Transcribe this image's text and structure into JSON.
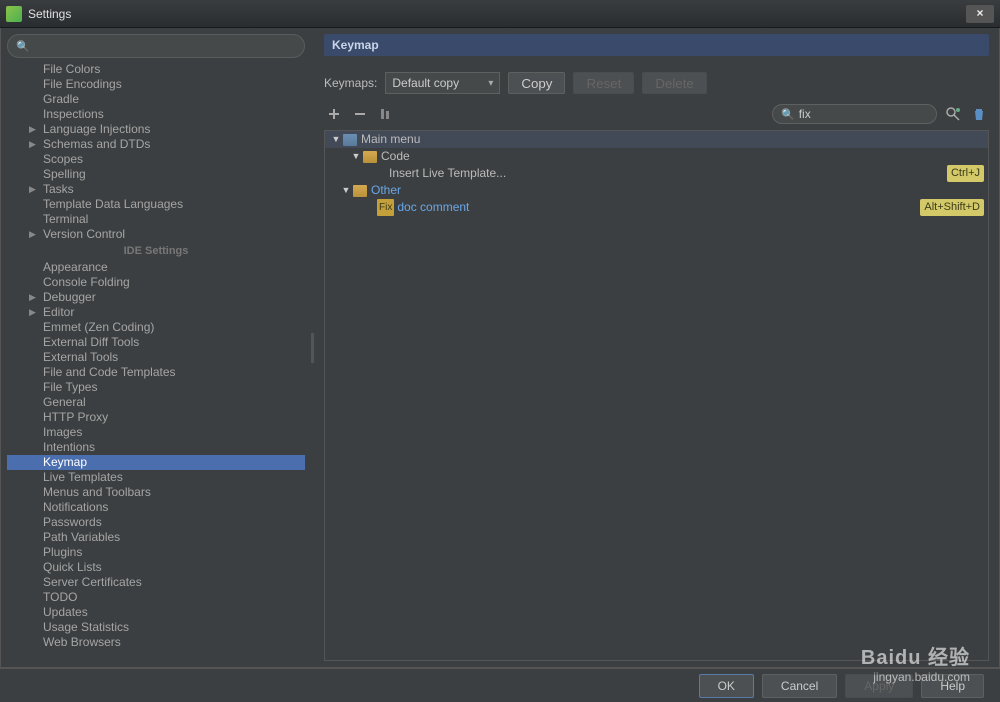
{
  "window": {
    "title": "Settings",
    "close": "×"
  },
  "sidebar": {
    "search_placeholder": "",
    "items1": [
      {
        "label": "File Colors",
        "arrow": ""
      },
      {
        "label": "File Encodings",
        "arrow": ""
      },
      {
        "label": "Gradle",
        "arrow": ""
      },
      {
        "label": "Inspections",
        "arrow": ""
      },
      {
        "label": "Language Injections",
        "arrow": "▶"
      },
      {
        "label": "Schemas and DTDs",
        "arrow": "▶"
      },
      {
        "label": "Scopes",
        "arrow": ""
      },
      {
        "label": "Spelling",
        "arrow": ""
      },
      {
        "label": "Tasks",
        "arrow": "▶"
      },
      {
        "label": "Template Data Languages",
        "arrow": ""
      },
      {
        "label": "Terminal",
        "arrow": ""
      },
      {
        "label": "Version Control",
        "arrow": "▶"
      }
    ],
    "ide_header": "IDE Settings",
    "items2": [
      {
        "label": "Appearance",
        "arrow": ""
      },
      {
        "label": "Console Folding",
        "arrow": ""
      },
      {
        "label": "Debugger",
        "arrow": "▶"
      },
      {
        "label": "Editor",
        "arrow": "▶"
      },
      {
        "label": "Emmet (Zen Coding)",
        "arrow": ""
      },
      {
        "label": "External Diff Tools",
        "arrow": ""
      },
      {
        "label": "External Tools",
        "arrow": ""
      },
      {
        "label": "File and Code Templates",
        "arrow": ""
      },
      {
        "label": "File Types",
        "arrow": ""
      },
      {
        "label": "General",
        "arrow": ""
      },
      {
        "label": "HTTP Proxy",
        "arrow": ""
      },
      {
        "label": "Images",
        "arrow": ""
      },
      {
        "label": "Intentions",
        "arrow": ""
      },
      {
        "label": "Keymap",
        "arrow": "",
        "selected": true
      },
      {
        "label": "Live Templates",
        "arrow": ""
      },
      {
        "label": "Menus and Toolbars",
        "arrow": ""
      },
      {
        "label": "Notifications",
        "arrow": ""
      },
      {
        "label": "Passwords",
        "arrow": ""
      },
      {
        "label": "Path Variables",
        "arrow": ""
      },
      {
        "label": "Plugins",
        "arrow": ""
      },
      {
        "label": "Quick Lists",
        "arrow": ""
      },
      {
        "label": "Server Certificates",
        "arrow": ""
      },
      {
        "label": "TODO",
        "arrow": ""
      },
      {
        "label": "Updates",
        "arrow": ""
      },
      {
        "label": "Usage Statistics",
        "arrow": ""
      },
      {
        "label": "Web Browsers",
        "arrow": ""
      }
    ]
  },
  "main": {
    "title": "Keymap",
    "keymaps_label": "Keymaps:",
    "keymaps_value": "Default copy",
    "copy_btn": "Copy",
    "reset_btn": "Reset",
    "delete_btn": "Delete",
    "filter_value": "fix",
    "tree": {
      "mainmenu": "Main menu",
      "code": "Code",
      "insert_template": "Insert Live Template...",
      "insert_template_shortcut": "Ctrl+J",
      "other": "Other",
      "fix_badge": "Fix",
      "doc_comment": "doc comment",
      "doc_comment_shortcut": "Alt+Shift+D"
    }
  },
  "footer": {
    "ok": "OK",
    "cancel": "Cancel",
    "apply": "Apply",
    "help": "Help"
  },
  "watermark": {
    "brand": "Baidu 经验",
    "url": "jingyan.baidu.com"
  }
}
